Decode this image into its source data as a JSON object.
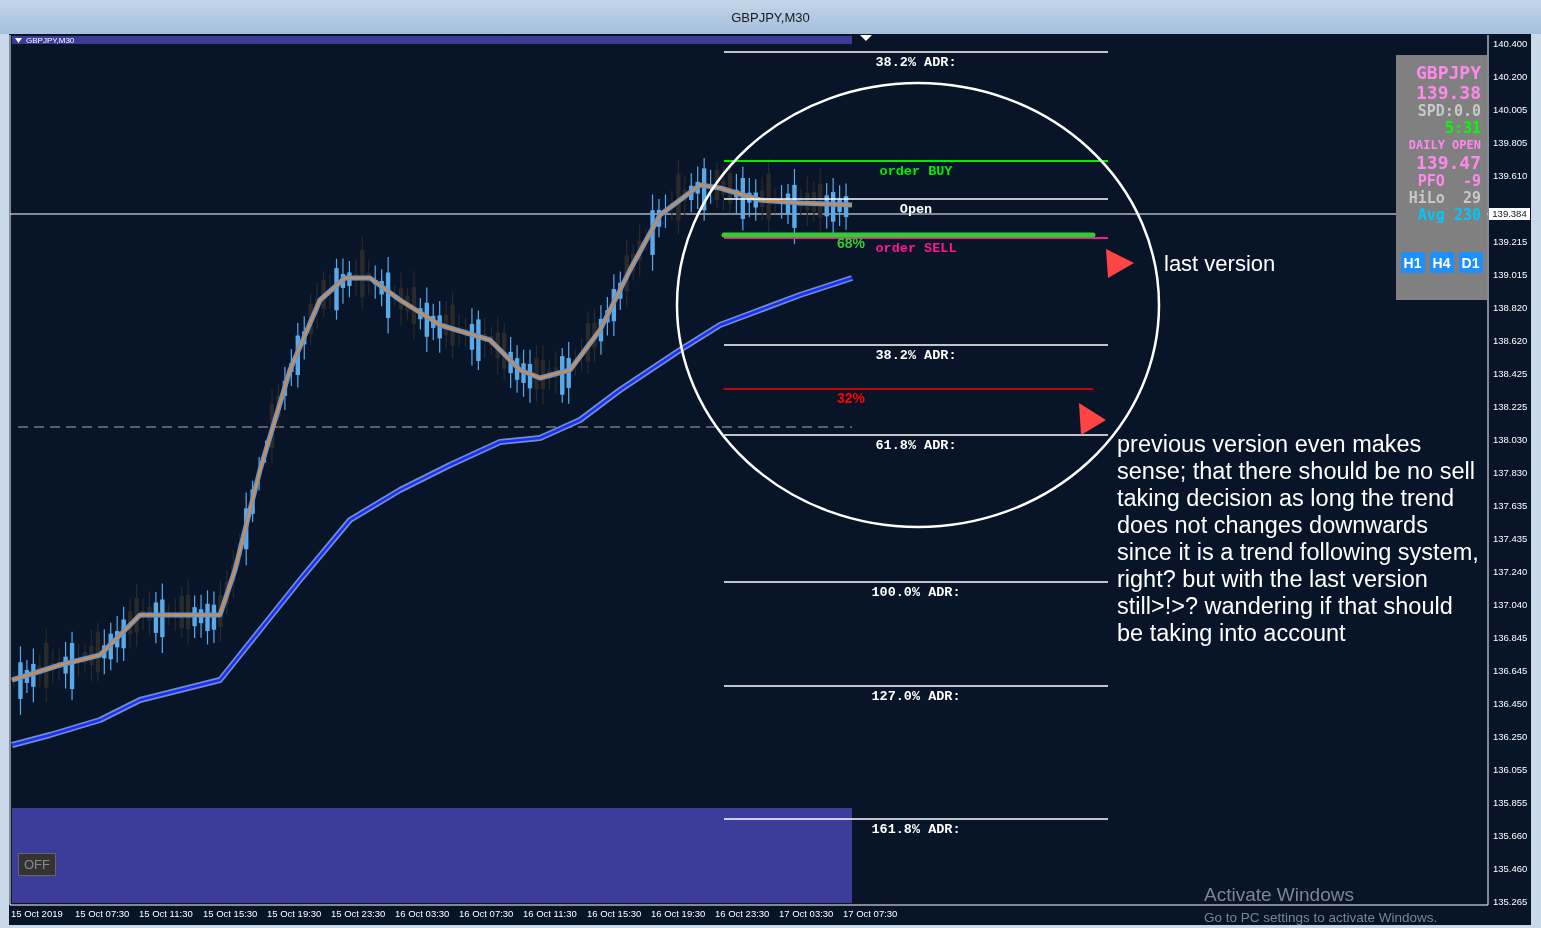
{
  "window": {
    "title": "GBPJPY,M30"
  },
  "chart": {
    "symbol_label": "GBPJPY,M30",
    "price_axis_upper": [
      "140.400",
      "140.200",
      "140.005",
      "139.805",
      "139.610"
    ],
    "price_axis_lower": [
      "139.215",
      "139.015",
      "138.820",
      "138.620",
      "138.425",
      "138.225",
      "138.030",
      "137.830",
      "137.635",
      "137.435",
      "137.240",
      "137.040",
      "136.845",
      "136.645",
      "136.450",
      "136.250",
      "136.055",
      "135.855",
      "135.660",
      "135.460",
      "135.265"
    ],
    "current_price": "139.384",
    "time_axis": [
      "15 Oct 2019",
      "15 Oct 07:30",
      "15 Oct 11:30",
      "15 Oct 15:30",
      "15 Oct 19:30",
      "15 Oct 23:30",
      "16 Oct 03:30",
      "16 Oct 07:30",
      "16 Oct 11:30",
      "16 Oct 15:30",
      "16 Oct 19:30",
      "16 Oct 23:30",
      "17 Oct 03:30",
      "17 Oct 07:30"
    ],
    "levels": [
      {
        "kind": "adr",
        "label": "38.2% ADR:"
      },
      {
        "kind": "buy",
        "label": "order BUY"
      },
      {
        "kind": "open",
        "label": "Open"
      },
      {
        "kind": "sell",
        "label": "order SELL"
      },
      {
        "kind": "adr",
        "label": "38.2% ADR:"
      },
      {
        "kind": "adr",
        "label": "61.8% ADR:"
      },
      {
        "kind": "adr",
        "label": "100.0% ADR:"
      },
      {
        "kind": "adr",
        "label": "127.0% ADR:"
      },
      {
        "kind": "adr",
        "label": "161.8% ADR:"
      }
    ],
    "range_markers": [
      {
        "label": "68%",
        "color": "#33cc33"
      },
      {
        "label": "32%",
        "color": "#ff0000"
      }
    ],
    "off_button": "OFF"
  },
  "info_panel": {
    "rows": [
      {
        "kind": "large",
        "text": "GBPJPY",
        "color": "#ff88ee"
      },
      {
        "kind": "large",
        "text": "139.38",
        "color": "#ff88ee"
      },
      {
        "kind": "medium",
        "text": "SPD:0.0",
        "color": "#c8c8c8"
      },
      {
        "kind": "medium",
        "text": "5:31",
        "color": "#00ff00"
      },
      {
        "kind": "small",
        "text": "DAILY OPEN",
        "color": "#ff88ee"
      },
      {
        "kind": "large",
        "text": "139.47",
        "color": "#ff88ee"
      },
      {
        "kind": "medium",
        "text": "PFO  -9",
        "color": "#ff88ee"
      },
      {
        "kind": "medium",
        "text": "HiLo  29",
        "color": "#c8c8c8"
      },
      {
        "kind": "medium",
        "text": "Avg 230",
        "color": "#00c8ff"
      }
    ],
    "buttons": [
      "H1",
      "H4",
      "D1"
    ]
  },
  "annotations": {
    "short_note": "last version",
    "long_note": "previous version even makes sense; that there should be no sell taking decision as long the trend does not changes downwards since it is a trend following system,  right? but with the last version still>!>? wandering if that should be taking into account"
  },
  "os_notice": {
    "title": "Activate Windows",
    "text": "Go to PC settings to activate Windows."
  }
}
